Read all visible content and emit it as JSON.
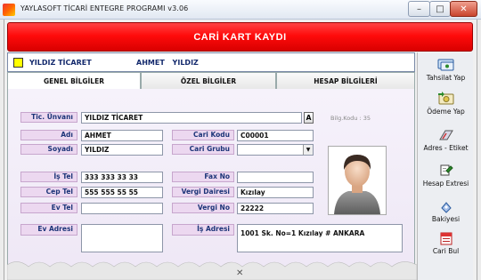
{
  "window": {
    "title": "YAYLASOFT TİCARİ ENTEGRE PROGRAMI v3.06",
    "min": "–",
    "max": "□",
    "close": "✕"
  },
  "header": {
    "title": "CARİ KART KAYDI"
  },
  "summary": {
    "firm": "YILDIZ TİCARET",
    "person": "AHMET  YILDIZ"
  },
  "tabs": [
    "GENEL BİLGİLER",
    "ÖZEL BİLGİLER",
    "HESAP BİLGİLERİ"
  ],
  "form": {
    "title_label": "Tic. Ünvanı",
    "title_value": "YILDIZ TİCARET",
    "title_btn": "A",
    "bilg_kodu": "Bilg.Kodu : 35",
    "first_label": "Adı",
    "first_value": "AHMET",
    "last_label": "Soyadı",
    "last_value": "YILDIZ",
    "code_label": "Cari Kodu",
    "code_value": "C00001",
    "group_label": "Cari Grubu",
    "group_value": "",
    "work_tel_label": "İş Tel",
    "work_tel_value": "333 333 33 33",
    "cell_label": "Cep Tel",
    "cell_value": "555 555 55 55",
    "home_tel_label": "Ev Tel",
    "home_tel_value": "",
    "fax_label": "Fax No",
    "fax_value": "",
    "tax_office_label": "Vergi Dairesi",
    "tax_office_value": "Kızılay",
    "tax_no_label": "Vergi No",
    "tax_no_value": "22222",
    "home_addr_label": "Ev Adresi",
    "home_addr_value": "",
    "work_addr_label": "İş Adresi",
    "work_addr_value": "1001 Sk. No=1 Kızılay # ANKARA"
  },
  "sidebar": [
    {
      "label": "Tahsilat Yap",
      "icon": "money-in-icon"
    },
    {
      "label": "Ödeme Yap",
      "icon": "money-out-icon"
    },
    {
      "label": "Adres - Etiket",
      "icon": "address-label-icon"
    },
    {
      "label": "Hesap Extresi",
      "icon": "account-statement-icon"
    },
    {
      "label": "Bakiyesi",
      "icon": "balance-icon"
    },
    {
      "label": "Cari Bul",
      "icon": "find-customer-icon"
    }
  ],
  "footer_glyph": "✕",
  "colors": {
    "header_red": "#ff0b0b",
    "label_bg": "#ecd8f0",
    "label_text": "#1c3478"
  }
}
